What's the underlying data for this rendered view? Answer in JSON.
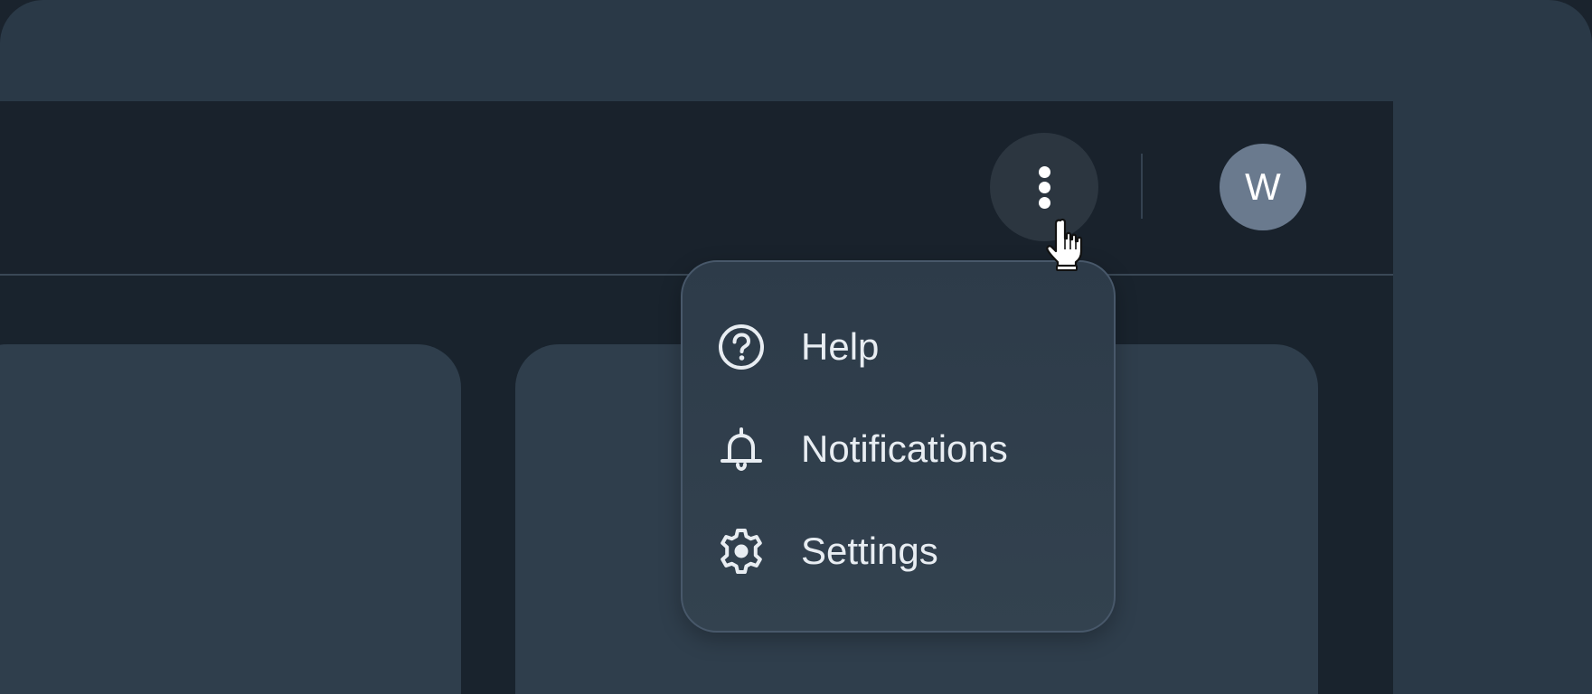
{
  "header": {
    "more_icon": "vertical-ellipsis",
    "avatar_initial": "W"
  },
  "menu": {
    "items": [
      {
        "label": "Help",
        "icon": "help-circle"
      },
      {
        "label": "Notifications",
        "icon": "bell"
      },
      {
        "label": "Settings",
        "icon": "gear"
      }
    ]
  },
  "cursor": {
    "icon": "pointer-hand"
  },
  "colors": {
    "background": "#2a3947",
    "app": "#19232d",
    "card": "#2f3e4c",
    "avatar": "#6a7a8e",
    "menu_border": "#48586a",
    "text": "#e8edf2"
  }
}
